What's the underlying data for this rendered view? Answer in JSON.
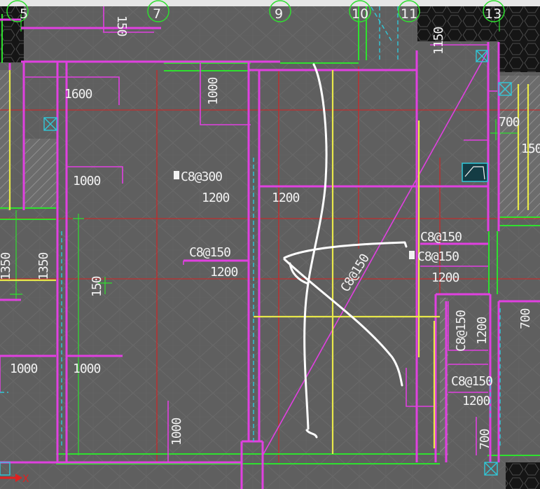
{
  "drawing": {
    "grid_axis_labels": [
      "5",
      "7",
      "9",
      "10",
      "11",
      "13"
    ],
    "top_clipped_labels": [
      "150",
      "1150"
    ],
    "dimensions": [
      {
        "id": "d1600",
        "text": "1600"
      },
      {
        "id": "d1000a",
        "text": "1000"
      },
      {
        "id": "d1000b",
        "text": "1000"
      },
      {
        "id": "d1200a",
        "text": "1200"
      },
      {
        "id": "d1200b",
        "text": "1200"
      },
      {
        "id": "d1200c",
        "text": "1200"
      },
      {
        "id": "d1200d",
        "text": "1200"
      },
      {
        "id": "d1200e",
        "text": "1200"
      },
      {
        "id": "d1200f",
        "text": "1200"
      },
      {
        "id": "d700a",
        "text": "700"
      },
      {
        "id": "d150a",
        "text": "150"
      },
      {
        "id": "d1350a",
        "text": "1350"
      },
      {
        "id": "d1350b",
        "text": "1350"
      },
      {
        "id": "d150b",
        "text": "150"
      },
      {
        "id": "d1000c",
        "text": "1000"
      },
      {
        "id": "d1000d",
        "text": "1000"
      },
      {
        "id": "d1000e",
        "text": "1000"
      },
      {
        "id": "d700b",
        "text": "700"
      },
      {
        "id": "d700c",
        "text": "700"
      }
    ],
    "rebar_labels": [
      {
        "id": "r1",
        "text": "C8@300"
      },
      {
        "id": "r2",
        "text": "C8@150"
      },
      {
        "id": "r3",
        "text": "C8@150"
      },
      {
        "id": "r4",
        "text": "C8@150"
      },
      {
        "id": "r5",
        "text": "C8@150"
      },
      {
        "id": "r6",
        "text": "C8@150"
      },
      {
        "id": "r7",
        "text": "C8@150"
      }
    ],
    "axis_indicator": "X",
    "colors": {
      "background": "#5f5f5f",
      "magenta": "#e040e0",
      "green": "#2fe02f",
      "yellow": "#e8e84a",
      "red": "#d82020",
      "cyan": "#30c8d8",
      "white": "#f2f2f2"
    }
  }
}
